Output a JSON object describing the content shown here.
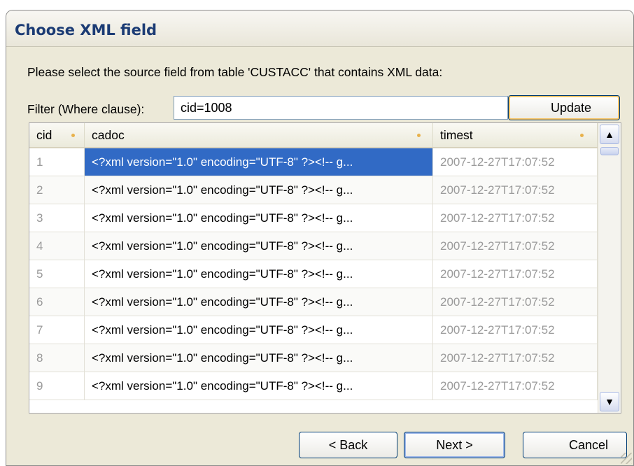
{
  "window": {
    "title": "Choose XML field"
  },
  "instruction": "Please select the source field from table 'CUSTACC' that contains XML data:",
  "filter": {
    "label": "Filter (Where clause):",
    "value": "cid=1008",
    "update_label": "Update"
  },
  "table": {
    "columns": [
      "cid",
      "cadoc",
      "timest"
    ],
    "rows": [
      {
        "cid": "1",
        "cadoc": "<?xml version=\"1.0\" encoding=\"UTF-8\" ?><!-- g...",
        "timest": "2007-12-27T17:07:52",
        "selected": true
      },
      {
        "cid": "2",
        "cadoc": "<?xml version=\"1.0\" encoding=\"UTF-8\" ?><!-- g...",
        "timest": "2007-12-27T17:07:52"
      },
      {
        "cid": "3",
        "cadoc": "<?xml version=\"1.0\" encoding=\"UTF-8\" ?><!-- g...",
        "timest": "2007-12-27T17:07:52"
      },
      {
        "cid": "4",
        "cadoc": "<?xml version=\"1.0\" encoding=\"UTF-8\" ?><!-- g...",
        "timest": "2007-12-27T17:07:52"
      },
      {
        "cid": "5",
        "cadoc": "<?xml version=\"1.0\" encoding=\"UTF-8\" ?><!-- g...",
        "timest": "2007-12-27T17:07:52"
      },
      {
        "cid": "6",
        "cadoc": "<?xml version=\"1.0\" encoding=\"UTF-8\" ?><!-- g...",
        "timest": "2007-12-27T17:07:52"
      },
      {
        "cid": "7",
        "cadoc": "<?xml version=\"1.0\" encoding=\"UTF-8\" ?><!-- g...",
        "timest": "2007-12-27T17:07:52"
      },
      {
        "cid": "8",
        "cadoc": "<?xml version=\"1.0\" encoding=\"UTF-8\" ?><!-- g...",
        "timest": "2007-12-27T17:07:52"
      },
      {
        "cid": "9",
        "cadoc": "<?xml version=\"1.0\" encoding=\"UTF-8\" ?><!-- g...",
        "timest": "2007-12-27T17:07:52"
      }
    ]
  },
  "scrollbar": {
    "up_icon": "▲",
    "down_icon": "▼"
  },
  "buttons": {
    "back": "< Back",
    "next": "Next >",
    "cancel": "Cancel"
  },
  "colors": {
    "selection": "#316ac5",
    "title_text": "#1b3b74",
    "focus_accent": "#f8c66a"
  }
}
